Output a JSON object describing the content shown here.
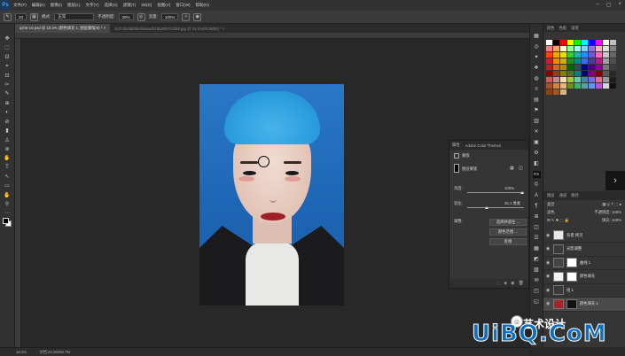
{
  "app": {
    "logo": "Ps"
  },
  "menu": [
    "文件(F)",
    "编辑(E)",
    "图像(I)",
    "图层(L)",
    "文字(Y)",
    "选择(S)",
    "滤镜(T)",
    "3D(D)",
    "视图(V)",
    "窗口(W)",
    "帮助(H)"
  ],
  "window_controls": [
    "–",
    "▢",
    "×"
  ],
  "options": {
    "brush_size": "20",
    "mode_label": "模式:",
    "mode_value": "正常",
    "opacity_label": "不透明度:",
    "opacity_value": "30%",
    "flow_label": "流量:",
    "flow_value": "100%"
  },
  "tabs": [
    {
      "label": "qzh5-10.psd @ 18.2% (颜色填充 1, 图层蒙版/8) * ×",
      "active": true
    },
    {
      "label": "0c07d2dabf6b0fa5ead318bd0f6731f68.jpg @ 16.6%(RGB/8#) *  ×",
      "active": false
    }
  ],
  "tools": [
    "✥",
    "⬚",
    "ʘ",
    "⌖",
    "⊡",
    "✂",
    "✎",
    "⊕",
    "◐",
    "⊘",
    "▮",
    "◬",
    "⊛",
    "✋",
    "T",
    "↖",
    "▭",
    "✋",
    "⚲",
    "⋯"
  ],
  "properties": {
    "tabs": [
      "属性",
      "Adobe Color Themes"
    ],
    "title": "蒙版",
    "mask_label": "图层蒙版",
    "density_label": "浓度:",
    "density_value": "100%",
    "feather_label": "羽化:",
    "feather_value": "26.1 像素",
    "refine_label": "调整:",
    "btn_select_mask": "选择并遮住 ...",
    "btn_color_range": "颜色范围 ...",
    "btn_invert": "反相",
    "footer_icons": [
      "⬚",
      "◈",
      "◉",
      "🗑"
    ]
  },
  "strip_icons": [
    "▦",
    "◎",
    "✦",
    "❖",
    "◍",
    "≡",
    "▤",
    "⚑",
    "▥",
    "✕",
    "▣",
    "⚙",
    "◧",
    "RS",
    "©",
    "A",
    "¶",
    "⊞",
    "◫",
    "☰",
    "▦",
    "◩",
    "▧",
    "✉",
    "◰",
    "◱"
  ],
  "swatches_panel": {
    "tabs": [
      "颜色",
      "色板",
      "渐变"
    ]
  },
  "swatch_colors": [
    "#ffffff",
    "#000000",
    "#ff0000",
    "#ffff00",
    "#00ff00",
    "#00ffff",
    "#0000ff",
    "#ff00ff",
    "#ffffff",
    "#c0c0c0",
    "#f08080",
    "#f4a460",
    "#fffacd",
    "#98fb98",
    "#afeeee",
    "#87cefa",
    "#9370db",
    "#ffb6c1",
    "#e0e0e0",
    "#808080",
    "#ff4500",
    "#ffa500",
    "#ffd700",
    "#32cd32",
    "#20b2aa",
    "#1e90ff",
    "#6a5acd",
    "#ff69b4",
    "#c8c8c8",
    "#666666",
    "#dc143c",
    "#ff8c00",
    "#daa520",
    "#228b22",
    "#008b8b",
    "#4169e1",
    "#483d8b",
    "#c71585",
    "#a0a0a0",
    "#505050",
    "#b22222",
    "#d2691e",
    "#b8860b",
    "#006400",
    "#2f4f4f",
    "#00008b",
    "#4b0082",
    "#8b008b",
    "#787878",
    "#3c3c3c",
    "#8b0000",
    "#8b4513",
    "#808000",
    "#556b2f",
    "#008080",
    "#000080",
    "#800080",
    "#800000",
    "#5a5a5a",
    "#282828",
    "#cd5c5c",
    "#bc8f8f",
    "#f5deb3",
    "#9acd32",
    "#66cdaa",
    "#4682b4",
    "#7b68ee",
    "#db7093",
    "#999999",
    "#1e1e1e",
    "#a0522d",
    "#cd853f",
    "#deb887",
    "#6b8e23",
    "#3cb371",
    "#5f9ea0",
    "#6495ed",
    "#ba55d3",
    "#d3d3d3",
    "#111111",
    "#8b4513",
    "#a0522d",
    "#d2b48c"
  ],
  "layers": {
    "tabs": [
      "图层",
      "通道",
      "路径"
    ],
    "kind": "类型",
    "blend": "滤色",
    "opacity_label": "不透明度:",
    "opacity_value": "100%",
    "fill_label": "填充:",
    "fill_value": "100%",
    "rows": [
      {
        "name": "背景 拷贝",
        "thumb": "#e8e8e8",
        "mask": false,
        "active": false
      },
      {
        "name": "光影调整",
        "thumb": "#3a3a3a",
        "mask": false,
        "active": false
      },
      {
        "name": "曲线 1",
        "thumb": "#444444",
        "mask": true,
        "active": false
      },
      {
        "name": "颜色填充",
        "thumb": "#f2f2f2",
        "mask": true,
        "active": false
      },
      {
        "name": "组 1",
        "thumb": "#3a3a3a",
        "mask": false,
        "active": false
      },
      {
        "name": "颜色填充 1",
        "thumb": "#a8242c",
        "mask": true,
        "active": true
      }
    ]
  },
  "status": {
    "zoom": "18.2%",
    "doc": "文档:23.2M/66.7M"
  },
  "watermark": {
    "logo": "☺",
    "text": "UiBQ.CoM",
    "chinese": "艺术设计"
  }
}
